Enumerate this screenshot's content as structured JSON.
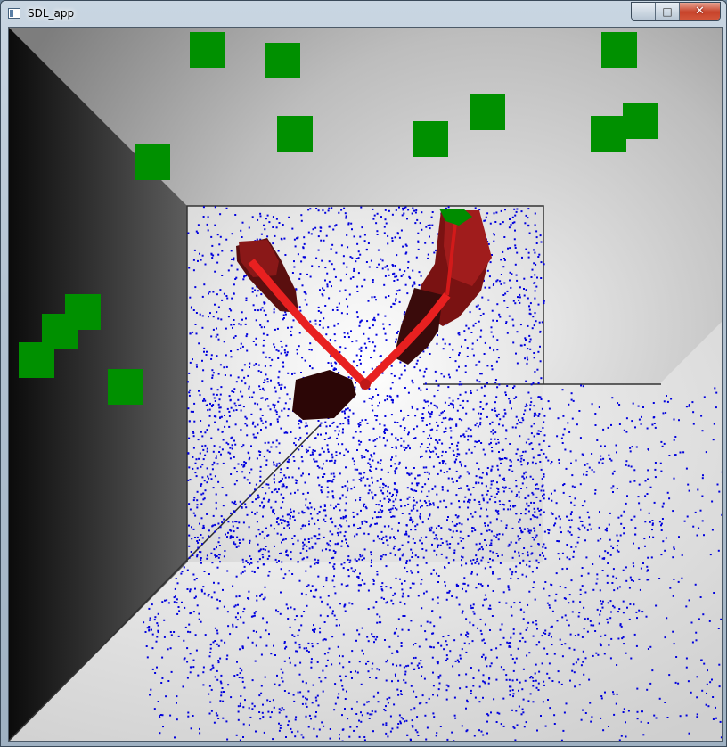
{
  "window": {
    "title": "SDL_app",
    "icon": "sdl-app-icon",
    "controls": {
      "minimize_icon": "minimize-icon",
      "maximize_icon": "maximize-icon",
      "close_icon": "close-icon",
      "minimize_glyph": "–",
      "maximize_glyph": "□",
      "close_glyph": "✕"
    }
  },
  "scene": {
    "colors": {
      "wall_dark": "#0d0d0d",
      "wall_mid": "#7a7a7a",
      "background_light": "#d8d8d8",
      "floor_light": "#f2f2f2",
      "particle": "#0000dd",
      "target": "#009000",
      "arm": "#e82020",
      "arm_shadow": "#4a0c0c",
      "outline": "#333333"
    },
    "target_count": 13,
    "arm_count": 2
  }
}
